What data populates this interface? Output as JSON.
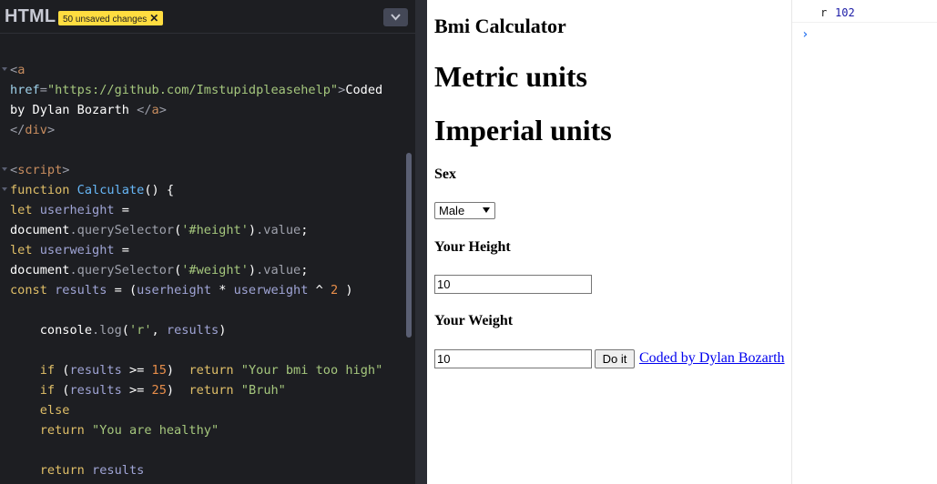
{
  "editor": {
    "title": "HTML",
    "badge": "50 unsaved changes",
    "badge_close": "✕"
  },
  "code_lines": [
    "",
    "",
    "<a",
    "href=\"https://github.com/Imstupidpleasehelp\">Coded",
    "by Dylan Bozarth </a>",
    "</div>",
    "",
    "<script>",
    "function Calculate() {",
    "let userheight =",
    "document.querySelector('#height').value;",
    "let userweight =",
    "document.querySelector('#weight').value;",
    "const results = (userheight * userweight ^ 2 )",
    "",
    "    console.log('r', results)",
    "",
    "    if (results >= 15)  return \"Your bmi too high\"",
    "    if (results >= 25)  return \"Bruh\"",
    "    else",
    "    return \"You are healthy\"",
    "",
    "    return results"
  ],
  "preview": {
    "title": "Bmi Calculator",
    "metric": "Metric units",
    "imperial": "Imperial units",
    "sex_label": "Sex",
    "sex_value": "Male",
    "height_label": "Your Height",
    "height_value": "10",
    "weight_label": "Your Weight",
    "weight_value": "10",
    "button": "Do it",
    "link": "Coded by Dylan Bozarth"
  },
  "console": {
    "key": "r",
    "value": "102",
    "prompt": "›"
  }
}
